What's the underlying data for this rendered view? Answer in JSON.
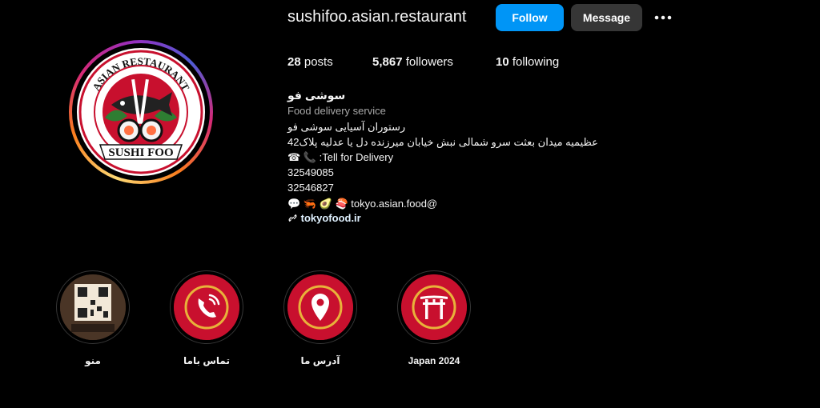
{
  "profile": {
    "username": "sushifoo.asian.restaurant",
    "follow_label": "Follow",
    "message_label": "Message",
    "more_icon": "more-options-icon",
    "avatar_text_top": "ASIAN RESTAURANT",
    "avatar_text_bottom": "SUSHI FOO"
  },
  "stats": {
    "posts_count": "28",
    "posts_label": "posts",
    "followers_count": "5,867",
    "followers_label": "followers",
    "following_count": "10",
    "following_label": "following"
  },
  "bio": {
    "name": "سوشی فو",
    "category": "Food delivery service",
    "line1": "رستوران آسیایی سوشی فو",
    "line2": "عظیمیه میدان بعثت سرو شمالی نبش خیابان میرزنده دل یا عدلیه پلاک42",
    "delivery_text": ":Tell for Delivery",
    "phone1": "32549085",
    "phone2": "32546827",
    "tokyo_handle": "tokyo.asian.food@",
    "link": "tokyofood.ir",
    "link_icon": "link-icon"
  },
  "highlights": [
    {
      "label": "منو",
      "icon": "qr-menu-thumbnail"
    },
    {
      "label": "تماس باما",
      "icon": "phone-ringing-icon"
    },
    {
      "label": "آدرس ما",
      "icon": "location-pin-icon"
    },
    {
      "label": "Japan 2024",
      "icon": "torii-gate-icon"
    }
  ],
  "colors": {
    "follow_button": "#0095f6",
    "message_button": "#363636",
    "highlight_red": "#c8102e",
    "highlight_gold": "#e8b23a",
    "background": "#000000"
  }
}
